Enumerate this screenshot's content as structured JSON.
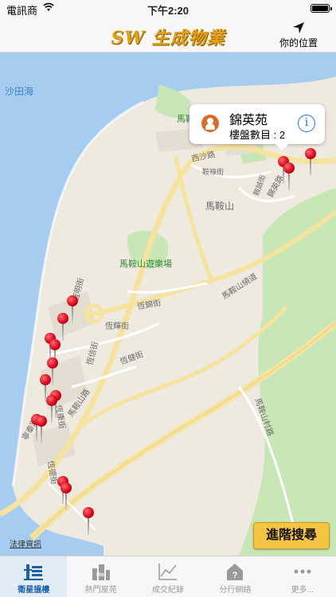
{
  "status_bar": {
    "carrier": "電訊商",
    "time": "下午2:20"
  },
  "nav": {
    "logo": "SW 生成物業",
    "location_button": "你的位置"
  },
  "map": {
    "labels": {
      "water": "沙田海",
      "park1": "馬鞍",
      "park2": "馬鞍山遊樂場",
      "place": "馬鞍山",
      "road_sai_sha": "西沙路",
      "road_on_luk": "鞍祿街",
      "road_mos_rd": "馬鞍山路",
      "road_mos_tsuen": "馬鞍山村路",
      "road_on_yiu": "恆錦街",
      "road_hang_fai": "恆輝街",
      "road_on_chun": "恆明街",
      "road_hang_tak": "恆德街",
      "road_hang_hong": "恆康街",
      "road_nin_wo": "寧泰路",
      "road_mos_tunnel": "馬鞍山繞道",
      "road_kam_ying": "錦英路",
      "road_hang_ming": "恆信街",
      "road_on_shing": "鞍誠街",
      "road_hang_kin": "恆健街"
    },
    "callout": {
      "title": "錦英苑",
      "count_label": "樓盤數目 : 2",
      "info_symbol": "i"
    },
    "pins_count": 16,
    "legal": "法律資訊",
    "advanced_search": "進階搜尋"
  },
  "tabs": [
    {
      "label": "衛星搵樓",
      "icon": "building-search-icon",
      "active": true
    },
    {
      "label": "熱門屋苑",
      "icon": "hot-buildings-icon",
      "active": false
    },
    {
      "label": "成交紀錄",
      "icon": "chart-line-icon",
      "active": false
    },
    {
      "label": "分行網絡",
      "icon": "branch-question-icon",
      "active": false
    },
    {
      "label": "更多...",
      "icon": "more-dots-icon",
      "active": false
    }
  ],
  "colors": {
    "accent": "#1a5fa8",
    "pin": "#d0021b",
    "button": "#f6c443",
    "water": "#a6cdf0",
    "park": "#c9e6b6"
  }
}
